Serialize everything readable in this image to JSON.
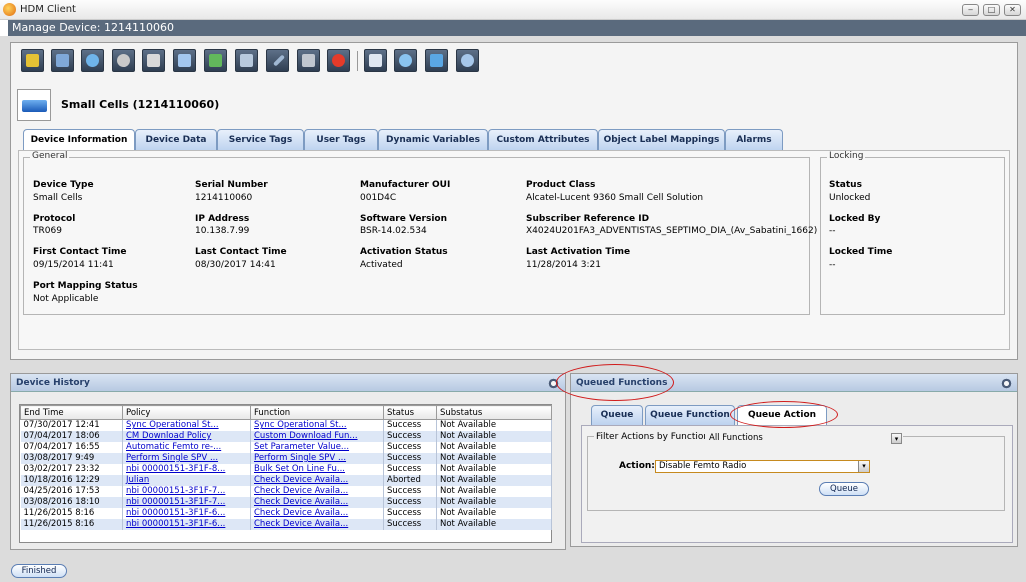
{
  "window": {
    "title": "HDM Client",
    "min": "‒",
    "max": "□",
    "close": "✕"
  },
  "manage_title": "Manage Device: 1214110060",
  "toolbar_icons": [
    "lock-icon",
    "undo-icon",
    "refresh-icon",
    "reboot-icon",
    "checklist-icon",
    "computer-icon",
    "export-icon",
    "delete-icon",
    "edit-icon",
    "tools-icon",
    "firmware-icon",
    "document-icon",
    "target-icon",
    "stack-icon",
    "search-icon"
  ],
  "device": {
    "title": "Small Cells (1214110060)"
  },
  "tabs": [
    "Device Information",
    "Device Data",
    "Service Tags",
    "User Tags",
    "Dynamic Variables",
    "Custom Attributes",
    "Object Label Mappings",
    "Alarms"
  ],
  "general": {
    "legend": "General",
    "device_type_label": "Device Type",
    "device_type": "Small Cells",
    "serial_label": "Serial Number",
    "serial": "1214110060",
    "oui_label": "Manufacturer OUI",
    "oui": "001D4C",
    "product_label": "Product Class",
    "product": "Alcatel-Lucent 9360 Small Cell Solution",
    "protocol_label": "Protocol",
    "protocol": "TR069",
    "ip_label": "IP Address",
    "ip": "10.138.7.99",
    "sw_label": "Software Version",
    "sw": "BSR-14.02.534",
    "sub_label": "Subscriber Reference ID",
    "sub": "X4024U201FA3_ADVENTISTAS_SEPTIMO_DIA_(Av_Sabatini_1662)",
    "first_label": "First Contact Time",
    "first": "09/15/2014 11:41",
    "last_label": "Last Contact Time",
    "last": "08/30/2017 14:41",
    "act_label": "Activation Status",
    "act": "Activated",
    "lastact_label": "Last Activation Time",
    "lastact": "11/28/2014 3:21",
    "port_label": "Port Mapping Status",
    "port": "Not Applicable"
  },
  "locking": {
    "legend": "Locking",
    "status_label": "Status",
    "status": "Unlocked",
    "by_label": "Locked By",
    "by": "--",
    "time_label": "Locked Time",
    "time": "--"
  },
  "history": {
    "title": "Device History",
    "columns": [
      "End Time",
      "Policy",
      "Function",
      "Status",
      "Substatus"
    ],
    "rows": [
      [
        "07/30/2017 12:41",
        "Sync Operational St...",
        "Sync Operational St...",
        "Success",
        "Not Available"
      ],
      [
        "07/04/2017 18:06",
        "CM Download Policy",
        "Custom Download Fun...",
        "Success",
        "Not Available"
      ],
      [
        "07/04/2017 16:55",
        "Automatic Femto re-...",
        "Set Parameter Value...",
        "Success",
        "Not Available"
      ],
      [
        "03/08/2017 9:49",
        "Perform Single SPV ...",
        "Perform Single SPV ...",
        "Success",
        "Not Available"
      ],
      [
        "03/02/2017 23:32",
        "nbi 00000151-3F1F-8...",
        "Bulk Set On Line Fu...",
        "Success",
        "Not Available"
      ],
      [
        "10/18/2016 12:29",
        "Julian",
        "Check Device Availa...",
        "Aborted",
        "Not Available"
      ],
      [
        "04/25/2016 17:53",
        "nbi 00000151-3F1F-7...",
        "Check Device Availa...",
        "Success",
        "Not Available"
      ],
      [
        "03/08/2016 18:10",
        "nbi 00000151-3F1F-7...",
        "Check Device Availa...",
        "Success",
        "Not Available"
      ],
      [
        "11/26/2015 8:16",
        "nbi 00000151-3F1F-6...",
        "Check Device Availa...",
        "Success",
        "Not Available"
      ],
      [
        "11/26/2015 8:16",
        "nbi 00000151-3F1F-6...",
        "Check Device Availa...",
        "Success",
        "Not Available"
      ]
    ]
  },
  "queued": {
    "title": "Queued Functions",
    "tabs": [
      "Queue",
      "Queue Function",
      "Queue Action"
    ],
    "filter_label": "Filter Actions by Function:",
    "filter_value": "All Functions",
    "action_label": "Action:",
    "action_value": "Disable Femto Radio",
    "queue_button": "Queue"
  },
  "status": {
    "finished": "Finished"
  },
  "colors": {
    "accent": "#bcd2ef",
    "highlight": "#d01c1c"
  }
}
